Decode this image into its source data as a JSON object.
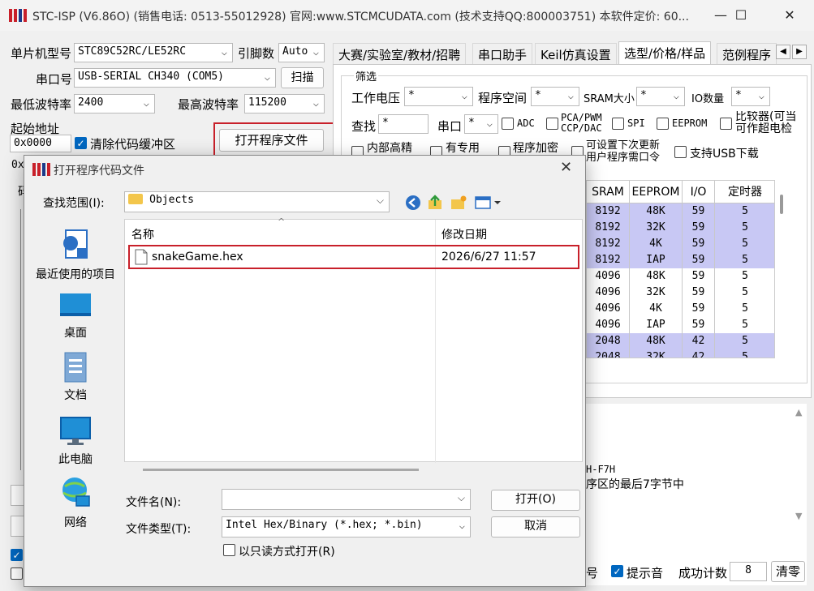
{
  "window": {
    "title": "STC-ISP (V6.86O) (销售电话: 0513-55012928) 官网:www.STCMCUDATA.com (技术支持QQ:800003751) 本软件定价: 60...",
    "minimize": "—",
    "maximize": "☐",
    "close": "✕"
  },
  "left_panel": {
    "mcu_label": "单片机型号",
    "mcu_value": "STC89C52RC/LE52RC",
    "pin_label": "引脚数",
    "pin_value": "Auto",
    "port_label": "串口号",
    "port_value": "USB-SERIAL CH340 (COM5)",
    "scan_button": "扫描",
    "min_baud_label": "最低波特率",
    "min_baud_value": "2400",
    "max_baud_label": "最高波特率",
    "max_baud_value": "115200",
    "start_addr_label": "起始地址",
    "start_addr_value": "0x0000",
    "clear_buffer_label": "清除代码缓冲区",
    "open_program_button": "打开程序文件",
    "addr2_value": "0x",
    "frag_code": "码"
  },
  "tabs": [
    "大赛/实验室/教材/招聘",
    "串口助手",
    "Keil仿真设置",
    "选型/价格/样品",
    "范例程序"
  ],
  "filter": {
    "group_label": "筛选",
    "voltage_label": "工作电压",
    "voltage_value": "*",
    "flash_label": "程序空间",
    "flash_value": "*",
    "sram_label": "SRAM大小",
    "sram_value": "*",
    "io_label": "IO数量",
    "io_value": "*",
    "find_label": "查找",
    "find_value": "*",
    "uart_label": "串口",
    "uart_value": "*",
    "chk_adc": "ADC",
    "chk_pca_line1": "PCA/PWM",
    "chk_pca_line2": "CCP/DAC",
    "chk_spi": "SPI",
    "chk_eeprom": "EEPROM",
    "chk_cmp_line1": "比较器(可当",
    "chk_cmp_line2": "可作超电检",
    "chk_internal": "内部高精",
    "chk_dedicated": "有专用",
    "chk_encrypt": "程序加密",
    "chk_update_line1": "可设置下次更新",
    "chk_update_line2": "用户程序需口令",
    "chk_usb": "支持USB下载"
  },
  "table": {
    "headers": [
      "SRAM",
      "EEPROM",
      "I/O",
      "定时器"
    ],
    "rows": [
      [
        "8192",
        "48K",
        "59",
        "5"
      ],
      [
        "8192",
        "32K",
        "59",
        "5"
      ],
      [
        "8192",
        "4K",
        "59",
        "5"
      ],
      [
        "8192",
        "IAP",
        "59",
        "5"
      ],
      [
        "4096",
        "48K",
        "59",
        "5"
      ],
      [
        "4096",
        "32K",
        "59",
        "5"
      ],
      [
        "4096",
        "4K",
        "59",
        "5"
      ],
      [
        "4096",
        "IAP",
        "59",
        "5"
      ],
      [
        "2048",
        "48K",
        "42",
        "5"
      ],
      [
        "2048",
        "32K",
        "42",
        "5"
      ]
    ],
    "highlight_color": "#c8c8f4"
  },
  "info": {
    "line1": "H-F7H",
    "line2": "序区的最后7字节中"
  },
  "bottom_bar": {
    "frag_left": "号",
    "beep_label": "提示音",
    "success_label": "成功计数",
    "success_value": "8",
    "clear_button": "清零"
  },
  "dialog": {
    "title": "打开程序代码文件",
    "close": "✕",
    "look_in_label": "查找范围(I):",
    "look_in_value": "Objects",
    "places": [
      "最近使用的项目",
      "桌面",
      "文档",
      "此电脑",
      "网络"
    ],
    "col_name": "名称",
    "col_date": "修改日期",
    "file_name": "snakeGame.hex",
    "file_date": "2026/6/27 11:57",
    "filename_label": "文件名(N):",
    "filename_value": "",
    "filetype_label": "文件类型(T):",
    "filetype_value": "Intel Hex/Binary (*.hex; *.bin)",
    "open_button": "打开(O)",
    "cancel_button": "取消",
    "readonly_label": "以只读方式打开(R)"
  },
  "accent_color": "#0067c0",
  "highlight_border_color": "#c8202a"
}
